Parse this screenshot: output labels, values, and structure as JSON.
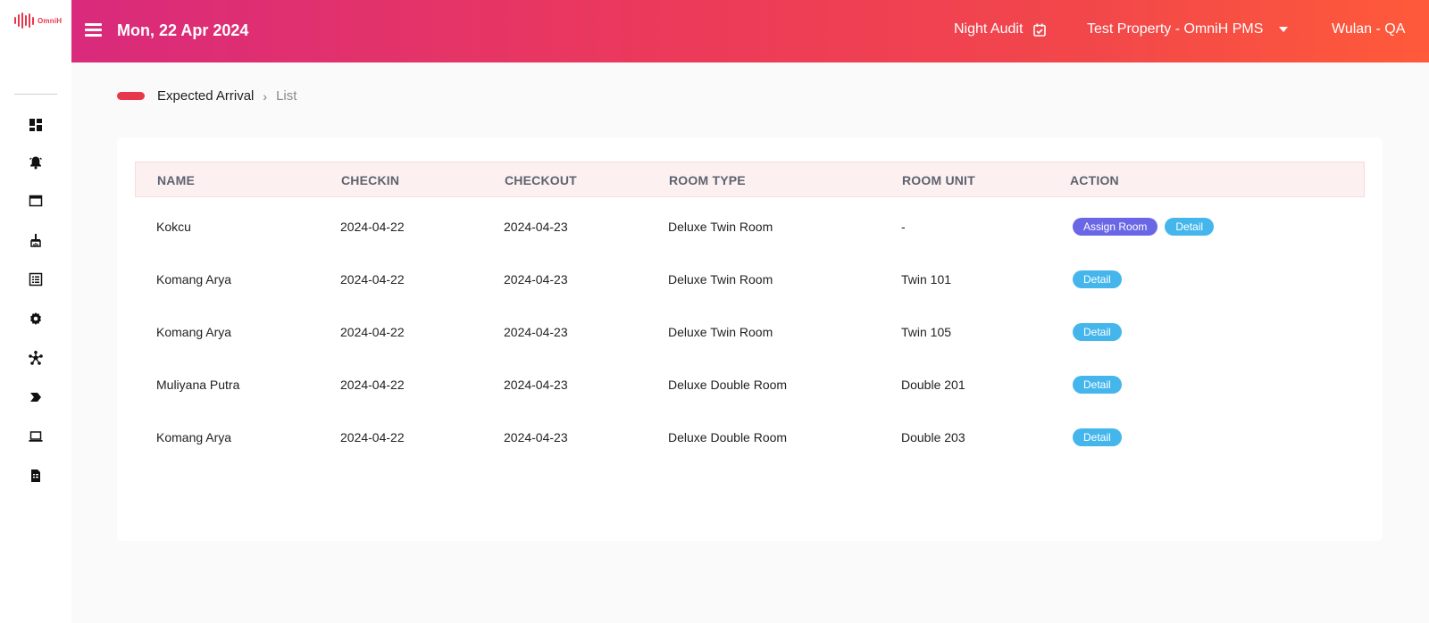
{
  "brand": {
    "logo_text": "OmniH",
    "accent": "#e8374d"
  },
  "header": {
    "date": "Mon, 22 Apr 2024",
    "night_audit": "Night Audit",
    "property": "Test Property - OmniH PMS",
    "user": "Wulan - QA",
    "gradient": [
      "#d92a7c",
      "#ff5a3a"
    ]
  },
  "sidebar": {
    "items": [
      {
        "icon": "dashboard-icon"
      },
      {
        "icon": "bell-icon"
      },
      {
        "icon": "window-icon"
      },
      {
        "icon": "cleaning-icon"
      },
      {
        "icon": "list-icon"
      },
      {
        "icon": "gear-icon"
      },
      {
        "icon": "network-icon"
      },
      {
        "icon": "chevron-tag-icon"
      },
      {
        "icon": "laptop-icon"
      },
      {
        "icon": "document-icon"
      }
    ]
  },
  "breadcrumb": {
    "parent": "Expected Arrival",
    "separator": "›",
    "current": "List"
  },
  "table": {
    "columns": [
      "NAME",
      "CHECKIN",
      "CHECKOUT",
      "ROOM TYPE",
      "ROOM UNIT",
      "ACTION"
    ],
    "rows": [
      {
        "name": "Kokcu",
        "checkin": "2024-04-22",
        "checkout": "2024-04-23",
        "room_type": "Deluxe Twin Room",
        "room_unit": "-",
        "assign": "Assign Room",
        "detail": "Detail"
      },
      {
        "name": "Komang Arya",
        "checkin": "2024-04-22",
        "checkout": "2024-04-23",
        "room_type": "Deluxe Twin Room",
        "room_unit": "Twin 101",
        "detail": "Detail"
      },
      {
        "name": "Komang Arya",
        "checkin": "2024-04-22",
        "checkout": "2024-04-23",
        "room_type": "Deluxe Twin Room",
        "room_unit": "Twin 105",
        "detail": "Detail"
      },
      {
        "name": "Muliyana Putra",
        "checkin": "2024-04-22",
        "checkout": "2024-04-23",
        "room_type": "Deluxe Double Room",
        "room_unit": "Double 201",
        "detail": "Detail"
      },
      {
        "name": "Komang Arya",
        "checkin": "2024-04-22",
        "checkout": "2024-04-23",
        "room_type": "Deluxe Double Room",
        "room_unit": "Double 203",
        "detail": "Detail"
      }
    ]
  },
  "colors": {
    "assign_badge": "#6a67e6",
    "detail_badge": "#45b6ec",
    "table_header_bg": "#fdf0f0"
  }
}
